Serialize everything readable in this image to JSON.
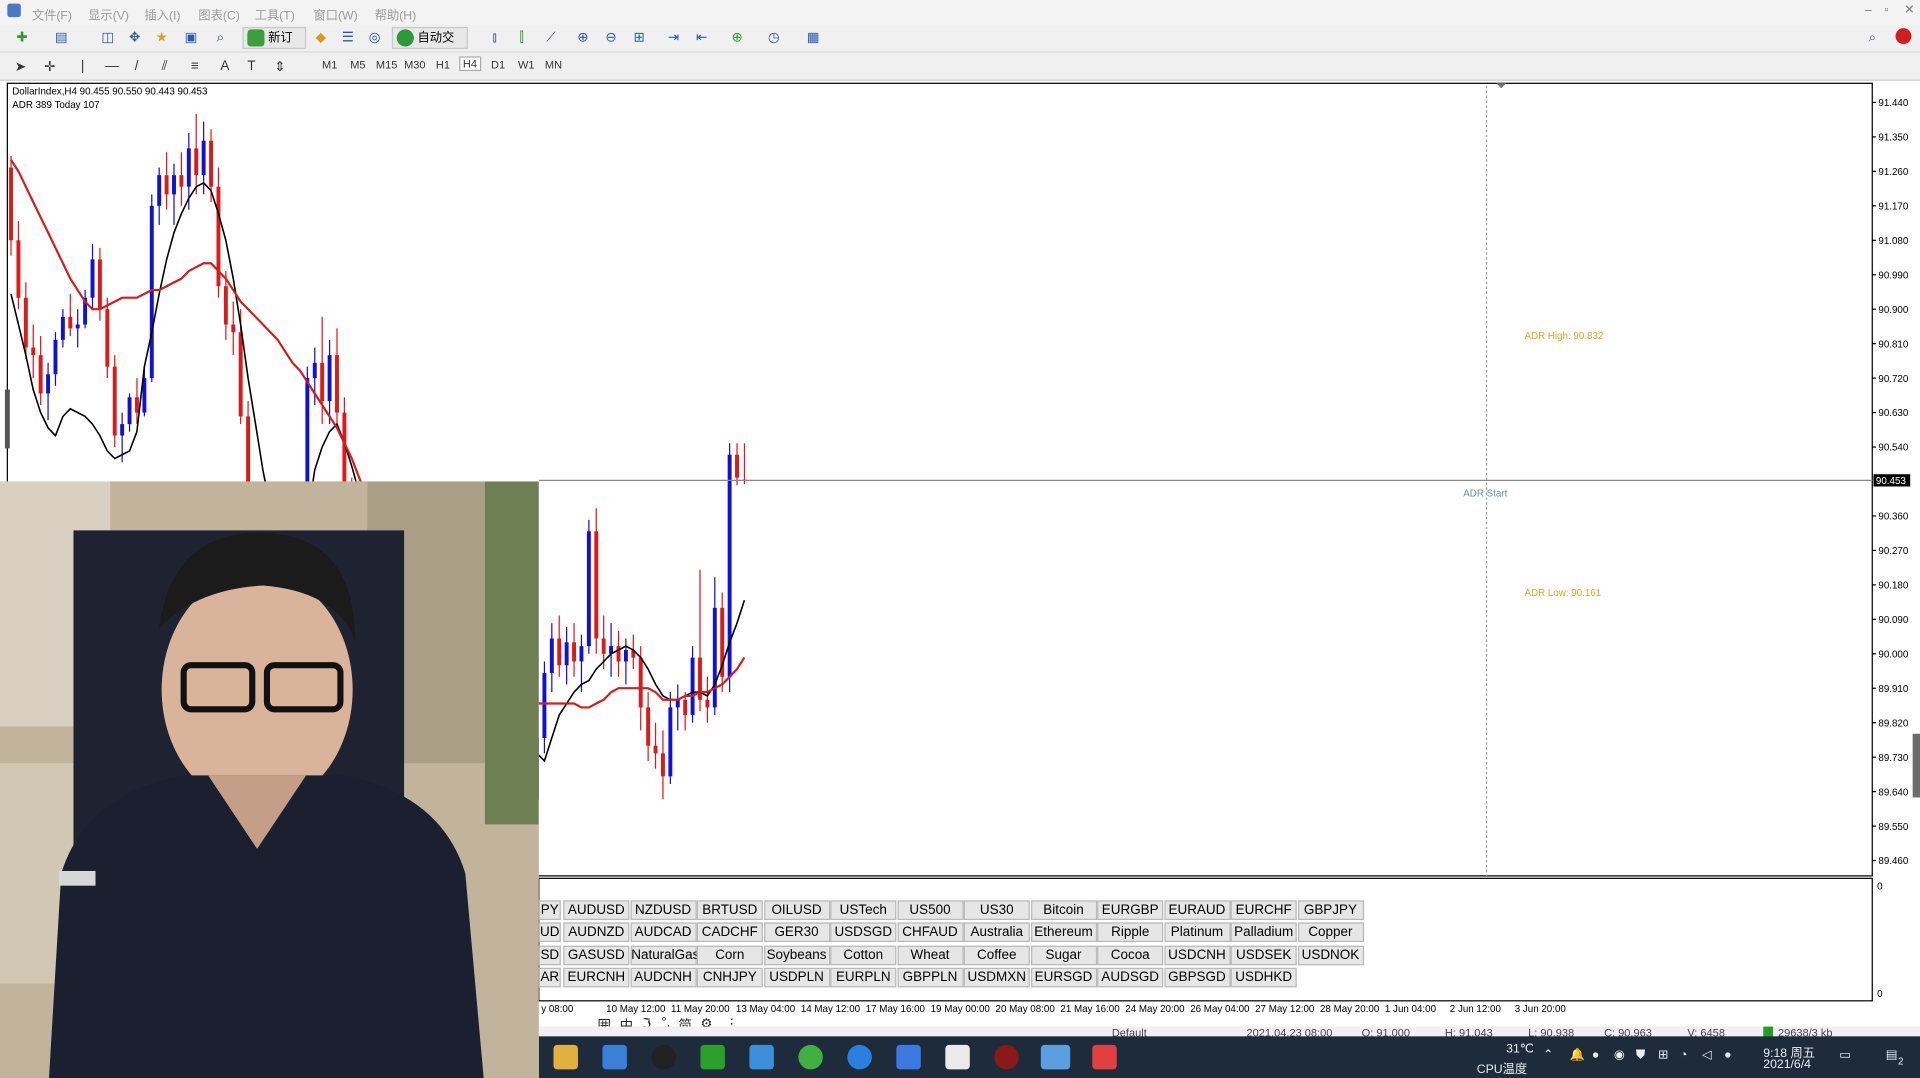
{
  "menu": [
    "文件(F)",
    "显示(V)",
    "插入(I)",
    "图表(C)",
    "工具(T)",
    "窗口(W)",
    "帮助(H)"
  ],
  "toolbar": {
    "new_order": "新订单",
    "auto_trading": "自动交易",
    "timeframes": [
      "M1",
      "M5",
      "M15",
      "M30",
      "H1",
      "H4",
      "D1",
      "W1",
      "MN"
    ],
    "active_timeframe": "H4"
  },
  "chart_header": {
    "title": "DollarIndex,H4  90.455 90.550 90.443 90.453",
    "indicator": "ADR 389  Today 107"
  },
  "chart_data": {
    "type": "candlestick",
    "symbol": "DollarIndex",
    "timeframe": "H4",
    "y_ticks": [
      "91.440",
      "91.350",
      "91.260",
      "91.170",
      "91.080",
      "90.990",
      "90.900",
      "90.810",
      "90.720",
      "90.630",
      "90.540",
      "90.453",
      "90.360",
      "90.270",
      "90.180",
      "90.090",
      "90.000",
      "89.910",
      "89.820",
      "89.730",
      "89.640",
      "89.550",
      "89.460"
    ],
    "ylim": [
      89.42,
      91.49
    ],
    "current_price": "90.453",
    "x_ticks": [
      "y 08:00",
      "10 May 12:00",
      "11 May 20:00",
      "13 May 04:00",
      "14 May 12:00",
      "17 May 16:00",
      "19 May 00:00",
      "20 May 08:00",
      "21 May 16:00",
      "24 May 20:00",
      "26 May 04:00",
      "27 May 12:00",
      "28 May 20:00",
      "1 Jun 04:00",
      "2 Jun 12:00",
      "3 Jun 20:00"
    ],
    "annotations": [
      {
        "text": "ADR High: 90.832",
        "price": 90.832,
        "color": "#e8a020"
      },
      {
        "text": "ADR Start",
        "price": 90.42,
        "color": "#5b8fc7"
      },
      {
        "text": "ADR Low: 90.161",
        "price": 90.161,
        "color": "#e8a020"
      }
    ],
    "series": [
      {
        "name": "MA fast",
        "color": "#000000",
        "values": [
          90.94,
          90.86,
          90.78,
          90.69,
          90.63,
          90.59,
          90.57,
          90.62,
          90.64,
          90.63,
          90.62,
          90.6,
          90.57,
          90.53,
          90.51,
          90.52,
          90.53,
          90.58,
          90.75,
          90.84,
          90.94,
          91.03,
          91.1,
          91.15,
          91.19,
          91.22,
          91.23,
          91.21,
          91.15,
          91.08,
          90.98,
          90.86,
          90.72,
          90.6,
          90.48,
          90.38,
          90.32,
          90.28,
          90.26,
          90.29,
          90.35,
          90.48,
          90.54,
          90.58,
          90.6,
          90.55,
          90.49,
          90.42,
          90.36,
          90.32,
          90.3,
          90.26,
          90.18,
          90.1,
          90.03,
          89.98,
          89.95,
          89.97,
          90.0,
          89.98,
          89.94,
          89.92,
          89.91,
          89.93,
          89.94,
          89.95,
          89.94,
          89.9,
          89.86,
          89.82,
          89.77,
          89.74,
          89.72,
          89.78,
          89.84,
          89.87,
          89.9,
          89.92,
          89.93,
          89.96,
          89.98,
          90.0,
          90.01,
          90.02,
          90.01,
          89.99,
          89.96,
          89.92,
          89.89,
          89.88,
          89.88,
          89.89,
          89.9,
          89.9,
          89.89,
          89.92,
          89.97,
          90.03,
          90.08,
          90.14
        ]
      },
      {
        "name": "MA slow",
        "color": "#d21e1e",
        "values": [
          91.29,
          91.26,
          91.22,
          91.18,
          91.14,
          91.1,
          91.06,
          91.02,
          90.98,
          90.95,
          90.92,
          90.9,
          90.9,
          90.91,
          90.92,
          90.93,
          90.93,
          90.93,
          90.94,
          90.95,
          90.95,
          90.96,
          90.97,
          90.98,
          91.0,
          91.01,
          91.02,
          91.02,
          91.0,
          90.98,
          90.95,
          90.92,
          90.9,
          90.88,
          90.86,
          90.84,
          90.82,
          90.79,
          90.76,
          90.74,
          90.71,
          90.68,
          90.65,
          90.62,
          90.59,
          90.55,
          90.51,
          90.46,
          90.41,
          90.36,
          90.31,
          90.28,
          90.28,
          90.28,
          90.26,
          90.24,
          90.22,
          90.2,
          90.17,
          90.14,
          90.11,
          90.08,
          90.04,
          90.0,
          89.96,
          89.93,
          89.9,
          89.88,
          89.87,
          89.87,
          89.87,
          89.87,
          89.87,
          89.87,
          89.87,
          89.87,
          89.87,
          89.86,
          89.86,
          89.87,
          89.88,
          89.9,
          89.91,
          89.91,
          89.91,
          89.91,
          89.91,
          89.9,
          89.88,
          89.88,
          89.88,
          89.89,
          89.89,
          89.9,
          89.9,
          89.91,
          89.92,
          89.94,
          89.96,
          89.99
        ]
      }
    ],
    "candles": [
      [
        91.27,
        91.3,
        91.04,
        91.08
      ],
      [
        91.08,
        91.13,
        90.9,
        90.93
      ],
      [
        90.93,
        90.97,
        90.77,
        90.8
      ],
      [
        90.8,
        90.86,
        90.72,
        90.78
      ],
      [
        90.78,
        90.83,
        90.65,
        90.68
      ],
      [
        90.68,
        90.76,
        90.61,
        90.73
      ],
      [
        90.73,
        90.84,
        90.7,
        90.82
      ],
      [
        90.82,
        90.9,
        90.8,
        90.88
      ],
      [
        90.88,
        90.94,
        90.83,
        90.85
      ],
      [
        90.85,
        90.9,
        90.8,
        90.86
      ],
      [
        90.86,
        90.95,
        90.85,
        90.93
      ],
      [
        90.93,
        91.07,
        90.9,
        91.03
      ],
      [
        91.03,
        91.06,
        90.87,
        90.9
      ],
      [
        90.9,
        90.93,
        90.72,
        90.75
      ],
      [
        90.75,
        90.78,
        90.54,
        90.57
      ],
      [
        90.57,
        90.63,
        90.5,
        90.6
      ],
      [
        90.6,
        90.68,
        90.58,
        90.67
      ],
      [
        90.67,
        90.72,
        90.6,
        90.63
      ],
      [
        90.63,
        90.75,
        90.62,
        90.72
      ],
      [
        90.72,
        91.2,
        90.71,
        91.17
      ],
      [
        91.17,
        91.27,
        91.12,
        91.25
      ],
      [
        91.25,
        91.31,
        91.16,
        91.2
      ],
      [
        91.2,
        91.28,
        91.12,
        91.25
      ],
      [
        91.25,
        91.31,
        91.17,
        91.22
      ],
      [
        91.22,
        91.36,
        91.16,
        91.32
      ],
      [
        91.32,
        91.41,
        91.2,
        91.25
      ],
      [
        91.25,
        91.39,
        91.2,
        91.34
      ],
      [
        91.34,
        91.37,
        91.18,
        91.22
      ],
      [
        91.22,
        91.27,
        90.93,
        90.96
      ],
      [
        90.96,
        91.0,
        90.82,
        90.86
      ],
      [
        90.86,
        90.92,
        90.78,
        90.84
      ],
      [
        90.84,
        90.9,
        90.6,
        90.62
      ],
      [
        90.62,
        90.66,
        90.3,
        90.33
      ],
      [
        90.33,
        90.38,
        90.17,
        90.21
      ],
      [
        90.21,
        90.3,
        90.0,
        90.05
      ],
      [
        90.05,
        90.23,
        90.0,
        90.18
      ],
      [
        90.18,
        90.3,
        90.15,
        90.26
      ],
      [
        90.26,
        90.33,
        90.02,
        90.07
      ],
      [
        90.07,
        90.37,
        90.04,
        90.35
      ],
      [
        90.35,
        90.4,
        90.15,
        90.2
      ],
      [
        90.2,
        90.75,
        90.18,
        90.72
      ],
      [
        90.72,
        90.8,
        90.65,
        90.76
      ],
      [
        90.76,
        90.88,
        90.6,
        90.66
      ],
      [
        90.66,
        90.82,
        90.6,
        90.78
      ],
      [
        90.78,
        90.85,
        90.6,
        90.63
      ],
      [
        90.63,
        90.67,
        90.38,
        90.42
      ],
      [
        90.42,
        90.46,
        90.27,
        90.3
      ],
      [
        90.3,
        90.34,
        90.22,
        90.28
      ],
      [
        90.28,
        90.4,
        90.24,
        90.36
      ],
      [
        90.36,
        90.42,
        90.16,
        90.2
      ],
      [
        90.2,
        90.26,
        89.96,
        90.0
      ],
      [
        90.0,
        90.07,
        89.72,
        89.76
      ],
      [
        89.76,
        89.9,
        89.66,
        89.84
      ],
      [
        89.84,
        90.0,
        89.7,
        89.92
      ],
      [
        89.92,
        89.96,
        89.7,
        89.75
      ],
      [
        89.75,
        90.25,
        89.72,
        90.18
      ],
      [
        90.18,
        90.23,
        90.05,
        90.11
      ],
      [
        90.11,
        90.16,
        89.9,
        89.93
      ],
      [
        89.93,
        89.98,
        89.72,
        89.76
      ],
      [
        89.76,
        89.82,
        89.66,
        89.74
      ],
      [
        89.74,
        89.84,
        89.62,
        89.8
      ],
      [
        89.8,
        90.04,
        89.76,
        90.0
      ],
      [
        90.0,
        90.08,
        89.94,
        89.98
      ],
      [
        89.98,
        90.05,
        89.88,
        90.02
      ],
      [
        90.02,
        90.1,
        89.94,
        89.96
      ],
      [
        89.96,
        90.0,
        89.82,
        89.86
      ],
      [
        89.86,
        89.92,
        89.7,
        89.74
      ],
      [
        89.74,
        89.8,
        89.64,
        89.68
      ],
      [
        89.68,
        89.84,
        89.5,
        89.55
      ],
      [
        89.55,
        89.7,
        89.52,
        89.66
      ],
      [
        89.66,
        89.78,
        89.58,
        89.62
      ],
      [
        89.62,
        89.82,
        89.58,
        89.78
      ],
      [
        89.78,
        89.98,
        89.74,
        89.95
      ],
      [
        89.95,
        90.08,
        89.9,
        90.04
      ],
      [
        90.04,
        90.1,
        89.94,
        89.97
      ],
      [
        89.97,
        90.07,
        89.92,
        90.03
      ],
      [
        90.03,
        90.08,
        89.94,
        89.98
      ],
      [
        89.98,
        90.05,
        89.9,
        90.02
      ],
      [
        90.02,
        90.35,
        90.0,
        90.32
      ],
      [
        90.32,
        90.38,
        90.0,
        90.04
      ],
      [
        90.04,
        90.1,
        89.96,
        90.0
      ],
      [
        90.0,
        90.08,
        89.94,
        90.02
      ],
      [
        90.02,
        90.06,
        89.94,
        89.98
      ],
      [
        89.98,
        90.04,
        89.92,
        90.01
      ],
      [
        90.01,
        90.05,
        89.96,
        89.99
      ],
      [
        89.99,
        90.02,
        89.8,
        89.86
      ],
      [
        89.86,
        89.9,
        89.72,
        89.76
      ],
      [
        89.76,
        89.82,
        89.7,
        89.74
      ],
      [
        89.74,
        89.8,
        89.62,
        89.68
      ],
      [
        89.68,
        89.9,
        89.66,
        89.86
      ],
      [
        89.86,
        89.92,
        89.8,
        89.88
      ],
      [
        89.88,
        89.9,
        89.8,
        89.84
      ],
      [
        89.84,
        90.02,
        89.82,
        89.99
      ],
      [
        89.99,
        90.22,
        89.85,
        89.88
      ],
      [
        89.88,
        89.94,
        89.82,
        89.86
      ],
      [
        89.86,
        90.2,
        89.84,
        90.12
      ],
      [
        90.12,
        90.16,
        89.9,
        89.94
      ],
      [
        89.94,
        90.55,
        89.9,
        90.52
      ],
      [
        90.52,
        90.55,
        90.44,
        90.46
      ],
      [
        90.455,
        90.55,
        90.443,
        90.453
      ]
    ]
  },
  "symbols": [
    [
      "PY",
      "AUDUSD",
      "NZDUSD",
      "BRTUSD",
      "OILUSD",
      "USTech",
      "US500",
      "US30",
      "Bitcoin",
      "EURGBP",
      "EURAUD",
      "EURCHF",
      "GBPJPY"
    ],
    [
      "UD",
      "AUDNZD",
      "AUDCAD",
      "CADCHF",
      "GER30",
      "USDSGD",
      "CHFAUD",
      "Australia",
      "Ethereum",
      "Ripple",
      "Platinum",
      "Palladium",
      "Copper"
    ],
    [
      "SD",
      "GASUSD",
      "NaturalGas",
      "Corn",
      "Soybeans",
      "Cotton",
      "Wheat",
      "Coffee",
      "Sugar",
      "Cocoa",
      "USDCNH",
      "USDSEK",
      "USDNOK"
    ],
    [
      "AR",
      "EURCNH",
      "AUDCNH",
      "CNHJPY",
      "USDPLN",
      "EURPLN",
      "GBPPLN",
      "USDMXN",
      "EURSGD",
      "AUDSGD",
      "GBPSGD",
      "USDHKD"
    ]
  ],
  "ime": [
    "囲",
    "中",
    "ℑ",
    "°,",
    "简",
    "⚙"
  ],
  "statusbar": {
    "profile": "Default",
    "datetime": "2021.04.23 08:00",
    "open": "O: 91.000",
    "high": "H: 91.043",
    "low": "L: 90.938",
    "close": "C: 90.963",
    "volume": "V: 6458",
    "traffic": "29638/3 kb"
  },
  "taskbar": {
    "temperature": "31℃",
    "cpu_label": "CPU温度",
    "time": "9:18 周五",
    "date": "2021/6/4",
    "notify_count": "2"
  },
  "colors": {
    "bull": "#1010dd",
    "bear": "#e01818",
    "ma_fast": "#000000",
    "ma_slow": "#d21e1e",
    "adr_label": "#e8a020"
  }
}
